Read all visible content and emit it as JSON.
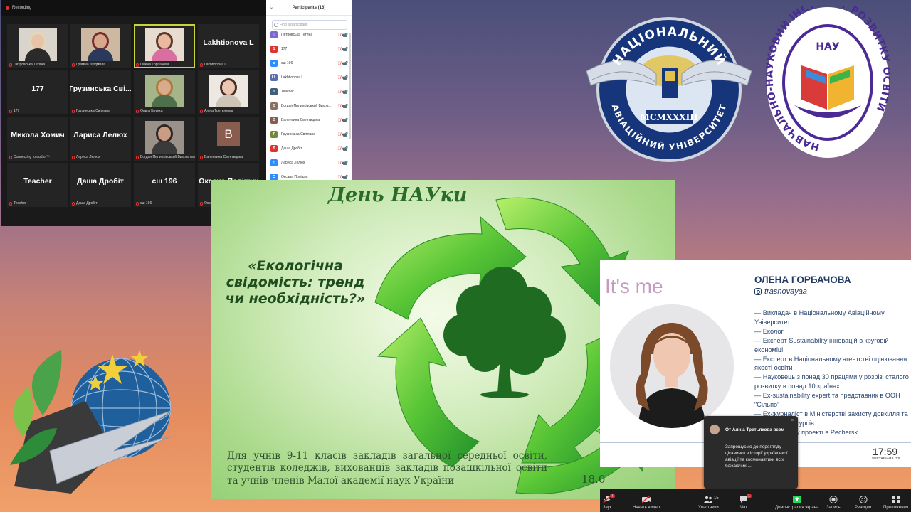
{
  "zoom": {
    "window_title": "Recording",
    "tiles": [
      {
        "name": "",
        "label": "Петровська Тетяна",
        "type": "video",
        "skin": "#e8c3a8",
        "hair": "#e3d7b5",
        "shirt": "#2a2a2a",
        "bg": "#d9d4cc"
      },
      {
        "name": "",
        "label": "Грамма Людмила",
        "type": "video",
        "skin": "#d8a88c",
        "hair": "#7c2a2a",
        "shirt": "#2b3a5a",
        "bg": "#cdb9a1"
      },
      {
        "name": "",
        "label": "Олена Горбачова",
        "type": "video",
        "skin": "#e9b9a0",
        "hair": "#5a3a2a",
        "shirt": "#d96fa0",
        "bg": "#e8dcd0",
        "active": true
      },
      {
        "name": "Lakhtionova L",
        "label": "Lakhtionova L",
        "type": "name"
      },
      {
        "name": "177",
        "label": "177",
        "type": "name"
      },
      {
        "name": "Грузинська Сві...",
        "label": "Грузинська Світлана",
        "type": "name"
      },
      {
        "name": "",
        "label": "Ольга Бруяка",
        "type": "video",
        "skin": "#d7ab8c",
        "hair": "#b07a3a",
        "shirt": "#4f6f4a",
        "bg": "#a6b48a"
      },
      {
        "name": "",
        "label": "Аліна Третьякова",
        "type": "video",
        "skin": "#ebc6b2",
        "hair": "#4a2e22",
        "shirt": "#cfc4b8",
        "bg": "#ede8e2"
      },
      {
        "name": "Микола Хомич",
        "label": "Connecting to audio ™",
        "type": "name"
      },
      {
        "name": "Лариса Лелюх",
        "label": "Лариса Лелюх",
        "type": "name"
      },
      {
        "name": "",
        "label": "Богдан Пилипківський Вихователь",
        "type": "video",
        "skin": "#c99d83",
        "hair": "#2e2622",
        "shirt": "#3a3a3a",
        "bg": "#9a9288"
      },
      {
        "name": "",
        "label": "Валентина Свентицька",
        "type": "avatar",
        "avatar": "B"
      },
      {
        "name": "Teacher",
        "label": "Teacher",
        "type": "name"
      },
      {
        "name": "Даша Дробіт",
        "label": "Даша Дробіт",
        "type": "name"
      },
      {
        "name": "сш 196",
        "label": "сш 196",
        "type": "name"
      },
      {
        "name": "Оксана Поліщук",
        "label": "Оксана Поліщук",
        "type": "name"
      }
    ],
    "participants": {
      "title": "Participants (16)",
      "search_placeholder": "Find a participant",
      "rows": [
        {
          "initial": "П",
          "name": "Петровська Тетяна",
          "color": "#7a6ad0"
        },
        {
          "initial": "1",
          "name": "177",
          "color": "#e0322f"
        },
        {
          "initial": "с",
          "name": "сш 196",
          "color": "#2d8cff"
        },
        {
          "initial": "LL",
          "name": "Lakhtionova L",
          "color": "#5b6fa8"
        },
        {
          "initial": "T",
          "name": "Teacher",
          "color": "#3f5e7a"
        },
        {
          "initial": "Б",
          "name": "Богдан Пилипківський Вихов...",
          "color": "#8a7060"
        },
        {
          "initial": "В",
          "name": "Валентина Свентицька",
          "color": "#8a5b4f"
        },
        {
          "initial": "Г",
          "name": "Грузинська Світлана",
          "color": "#6e8a3a"
        },
        {
          "initial": "Д",
          "name": "Даша Дробіт",
          "color": "#e0322f"
        },
        {
          "initial": "Л",
          "name": "Лариса Лелюх",
          "color": "#2d8cff"
        },
        {
          "initial": "О",
          "name": "Оксана Поліщук",
          "color": "#2d8cff"
        }
      ]
    }
  },
  "emblem": {
    "top": "НАЦІОНАЛЬНИЙ",
    "bottom": "АВІАЦІЙНИЙ УНІВЕРСИТЕТ",
    "year": "MCMXXXIII",
    "colors": {
      "navy": "#17357a",
      "silver": "#d7dde6",
      "gold": "#d8b43a"
    }
  },
  "institute": {
    "abbr": "НАУ",
    "ring_text": "НАВЧАЛЬНО-НАУКОВИЙ ІНСТИТУТ РОЗВИТКУ ОСВІТИ",
    "colors": {
      "purple": "#4b2a96",
      "ring": "#ffffff"
    }
  },
  "slide": {
    "title": "День НАУки",
    "question": "«Екологічна свідомість: тренд чи необхідність?»",
    "audience": "Для учнів 9-11 класів закладів загальної середньої освіти, студентів коледжів, вихованців закладів позашкільної освіти та учнів-членів Малої академії наук України",
    "date": "18.0"
  },
  "presenter": {
    "heading": "It's me",
    "name": "ОЛЕНА ГОРБАЧОВА",
    "handle": "trashovayaa",
    "bio": [
      "— Викладач в Національному Авіаційному Університеті",
      "— Еколог",
      "— Експерт Sustainability інновацій в круговій економіці",
      "— Експерт в Національному агентстві оцінювання якості освіти",
      "— Науковець з понад 30 працями у розрізі сталого розвитку в понад 10 країнах",
      "— Ex-sustainability expert та представник в ООН \"Сільпо\"",
      "— Ex-журналіст в Міністерстві захисту довкілля та природних ресурсів",
      "в екологічному проекті в Pechersk",
      "hool"
    ],
    "time": "17:59",
    "brand": "SUSTAINABILITY"
  },
  "chat": {
    "sender": "От Аліна Третьякова всем",
    "message": "Запрошуємо до перегляду цікавинок з історії української авіації та космонавтики всіх бажаючих ...",
    "close": "×"
  },
  "controls": [
    {
      "label": "Звук",
      "icon": "mic-off-icon",
      "badge": "!"
    },
    {
      "label": "Начать видео",
      "icon": "video-off-icon"
    },
    {
      "label": "Участники",
      "icon": "participants-icon",
      "count": "15"
    },
    {
      "label": "Чат",
      "icon": "chat-icon",
      "badge": "1"
    },
    {
      "label": "Демонстрация экрана",
      "icon": "share-screen-icon"
    },
    {
      "label": "Запись",
      "icon": "record-icon"
    },
    {
      "label": "Реакции",
      "icon": "reactions-icon"
    },
    {
      "label": "Приложения",
      "icon": "apps-icon"
    }
  ]
}
